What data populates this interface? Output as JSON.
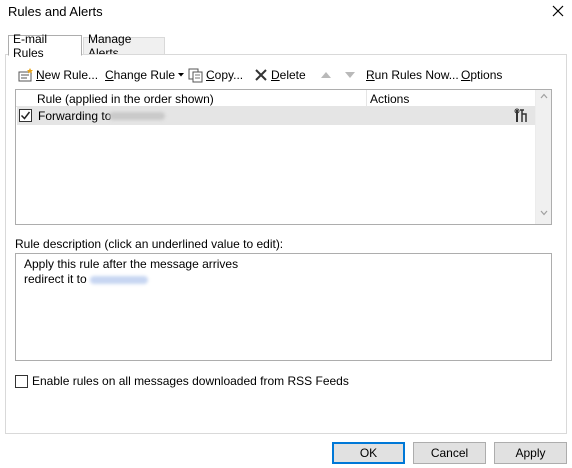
{
  "window": {
    "title": "Rules and Alerts"
  },
  "tabs": [
    {
      "label": "E-mail Rules"
    },
    {
      "label": "Manage Alerts"
    }
  ],
  "toolbar": {
    "new_rule_n": "N",
    "new_rule_rest": "ew Rule...",
    "change_rule_c": "C",
    "change_rule_rest": "hange Rule",
    "copy_c": "C",
    "copy_rest": "opy...",
    "delete_d": "D",
    "delete_rest": "elete",
    "run_r": "R",
    "run_rest": "un Rules Now...",
    "options_o": "O",
    "options_rest": "ptions"
  },
  "rules_list": {
    "column_rule": "Rule (applied in the order shown)",
    "column_actions": "Actions",
    "rows": [
      {
        "name": "Forwarding to",
        "checked": true
      }
    ]
  },
  "description": {
    "label": "Rule description (click an underlined value to edit):",
    "line1": "Apply this rule after the message arrives",
    "line2": "redirect it to"
  },
  "rss": {
    "label": "Enable rules on all messages downloaded from RSS Feeds",
    "checked": false
  },
  "buttons": {
    "ok": "OK",
    "cancel": "Cancel",
    "apply": "Apply"
  },
  "colors": {
    "accent": "#0078d7",
    "selection": "#e5e5e5",
    "disabled": "#b9b9b9"
  }
}
